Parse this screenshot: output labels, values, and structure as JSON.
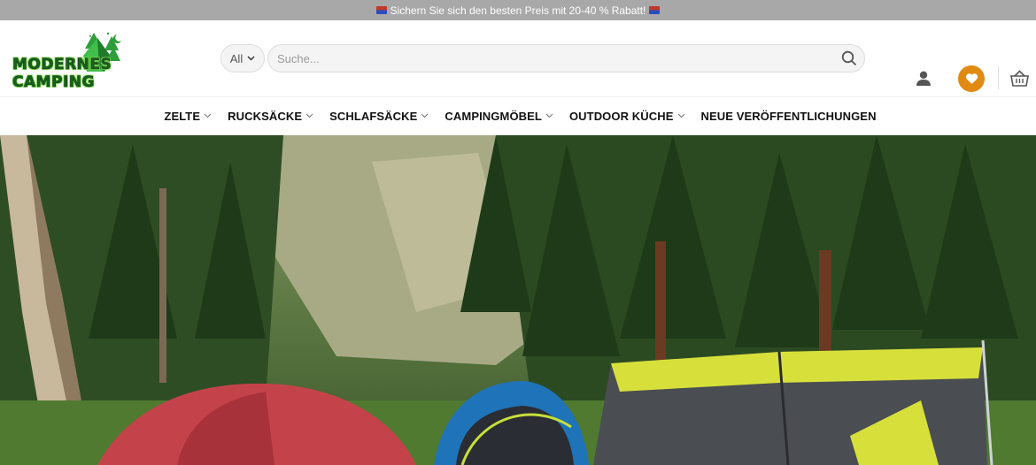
{
  "announcement": {
    "text": "Sichern Sie sich den besten Preis mit 20-40 % Rabatt!"
  },
  "logo": {
    "text": "MODERNES CAMPING"
  },
  "search": {
    "category": "All",
    "placeholder": "Suche..."
  },
  "nav": {
    "items": [
      {
        "label": "ZELTE",
        "dropdown": true
      },
      {
        "label": "RUCKSÄCKE",
        "dropdown": true
      },
      {
        "label": "SCHLAFSÄCKE",
        "dropdown": true
      },
      {
        "label": "CAMPINGMÖBEL",
        "dropdown": true
      },
      {
        "label": "OUTDOOR KÜCHE",
        "dropdown": true
      },
      {
        "label": "NEUE VERÖFFENTLICHUNGEN",
        "dropdown": false
      }
    ]
  },
  "colors": {
    "accent": "#e08a14",
    "topbar": "#a8a8a8",
    "logo_green": "#2e9e3a"
  },
  "icons": [
    "user-icon",
    "heart-icon",
    "basket-icon",
    "search-icon",
    "chevron-down-icon"
  ]
}
